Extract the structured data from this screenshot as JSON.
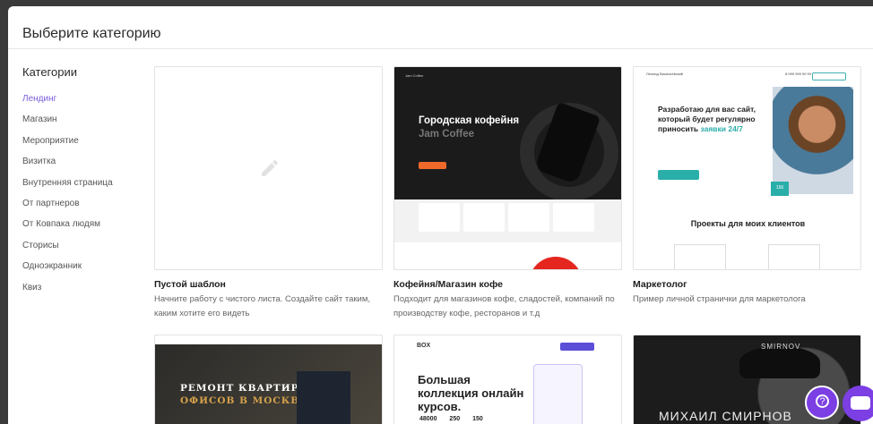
{
  "modal": {
    "title": "Выберите категорию"
  },
  "sidebar": {
    "heading": "Категории",
    "items": [
      {
        "label": "Лендинг",
        "active": true
      },
      {
        "label": "Магазин"
      },
      {
        "label": "Мероприятие"
      },
      {
        "label": "Визитка"
      },
      {
        "label": "Внутренняя страница"
      },
      {
        "label": "От партнеров"
      },
      {
        "label": "От Ковпака людям"
      },
      {
        "label": "Сторисы"
      },
      {
        "label": "Одноэкранник"
      },
      {
        "label": "Квиз"
      }
    ]
  },
  "templates": [
    {
      "title": "Пустой шаблон",
      "description": "Начните работу с чистого листа. Создайте сайт таким, каким хотите его видеть",
      "icon": "pencil-icon"
    },
    {
      "title": "Кофейня/Магазин кофе",
      "description": "Подходит для магазинов кофе, сладостей, компаний по производству кофе, ресторанов и т.д",
      "preview": {
        "brand": "Jam Coffee",
        "headline_1": "Городская кофейня",
        "headline_2": "Jam Coffee"
      }
    },
    {
      "title": "Маркетолог",
      "description": "Пример личной странички для маркетолога",
      "preview": {
        "name": "Леонид Васильевский",
        "phone": "8 999 999 99 99",
        "headline": "Разработаю для вас сайт, который будет регулярно приносить",
        "headline_accent": "заявки 24/7",
        "badge": "156",
        "section": "Проекты для моих клиентов"
      }
    },
    {
      "preview": {
        "headline_1": "РЕМОНТ КВАРТИР И",
        "headline_2": "ОФИСОВ В МОСКВЕ"
      }
    },
    {
      "preview": {
        "logo": "BOX",
        "headline": "Большая коллекция онлайн курсов.",
        "numbers": [
          "48000",
          "250",
          "150"
        ]
      }
    },
    {
      "preview": {
        "name": "SMIRNOV",
        "big": "МИХАИЛ СМИРНОВ"
      }
    }
  ],
  "colors": {
    "accent": "#7b5cdb",
    "fab": "#7b3fe4"
  },
  "fab": {
    "help_icon": "question-icon",
    "chat_icon": "chat-icon",
    "help_glyph": "?"
  }
}
